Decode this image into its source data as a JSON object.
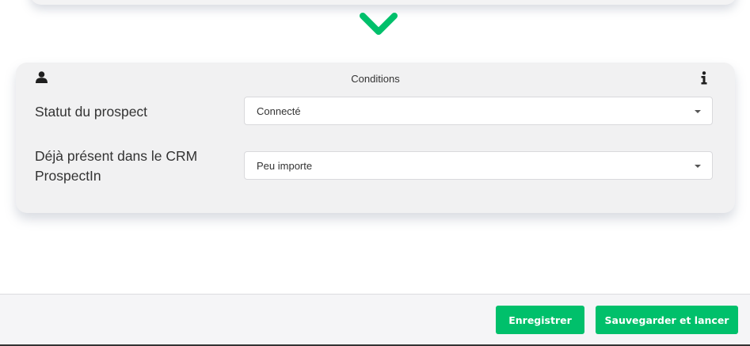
{
  "card": {
    "title": "Conditions",
    "header_icons": [
      "user-icon",
      "info-icon"
    ]
  },
  "conditions": [
    {
      "label": "Statut du prospect",
      "value": "Connecté"
    },
    {
      "label": "Déjà présent dans le CRM ProspectIn",
      "value": "Peu importe"
    }
  ],
  "footer": {
    "save_label": "Enregistrer",
    "save_launch_label": "Sauvegarder et lancer"
  },
  "colors": {
    "accent": "#00c06b",
    "card_bg": "#f1f1f2"
  }
}
